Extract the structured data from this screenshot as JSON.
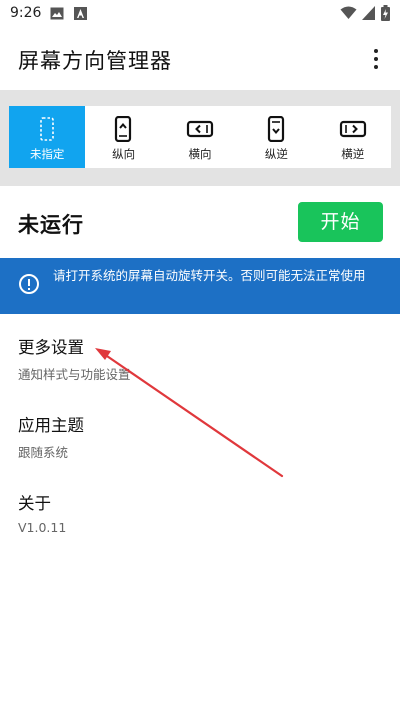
{
  "status_bar": {
    "time": "9:26"
  },
  "app_bar": {
    "title": "屏幕方向管理器"
  },
  "orientations": [
    {
      "label": "未指定",
      "icon": "unspecified-orientation-icon",
      "active": true
    },
    {
      "label": "纵向",
      "icon": "portrait-icon",
      "active": false
    },
    {
      "label": "横向",
      "icon": "landscape-icon",
      "active": false
    },
    {
      "label": "纵逆",
      "icon": "reverse-portrait-icon",
      "active": false
    },
    {
      "label": "横逆",
      "icon": "reverse-landscape-icon",
      "active": false
    }
  ],
  "service": {
    "status": "未运行",
    "start_label": "开始"
  },
  "banner": {
    "text": "请打开系统的屏幕自动旋转开关。否则可能无法正常使用"
  },
  "settings": [
    {
      "title": "更多设置",
      "subtitle": "通知样式与功能设置"
    },
    {
      "title": "应用主题",
      "subtitle": "跟随系统"
    },
    {
      "title": "关于",
      "subtitle": "V1.0.11"
    }
  ],
  "colors": {
    "accent": "#11a4ef",
    "start_button": "#19c45b",
    "banner": "#1d70c5",
    "annotation": "#e0383c"
  }
}
